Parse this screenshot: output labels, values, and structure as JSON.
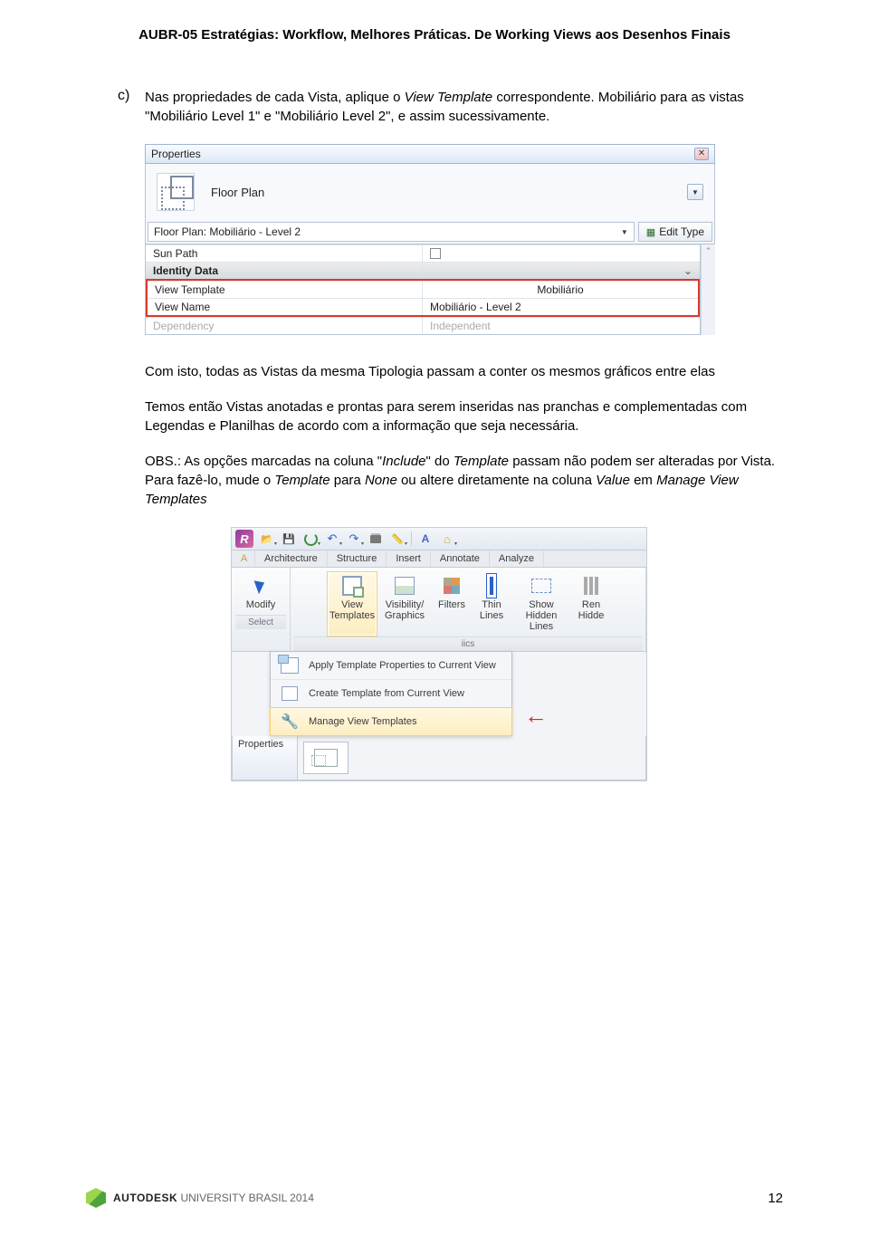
{
  "header": "AUBR-05 Estratégias: Workflow, Melhores Práticas. De Working Views aos Desenhos Finais",
  "list": {
    "marker": "c)",
    "text_before": "Nas propriedades de cada Vista, aplique o ",
    "italic1": "View Template",
    "text_mid": " correspondente. Mobiliário para as vistas \"Mobiliário Level 1\" e \"Mobiliário Level 2\", e assim sucessivamente."
  },
  "props": {
    "title": "Properties",
    "type_name": "Floor Plan",
    "instance": "Floor Plan: Mobiliário - Level 2",
    "edit_type": "Edit Type",
    "rows": {
      "sun_path": "Sun Path",
      "identity": "Identity Data",
      "vt_label": "View Template",
      "vt_value": "Mobiliário",
      "vn_label": "View Name",
      "vn_value": "Mobiliário - Level 2",
      "dep_label": "Dependency",
      "dep_value": "Independent"
    },
    "chevron": "⌃"
  },
  "para1": "Com isto, todas as Vistas da mesma Tipologia passam a conter os mesmos gráficos entre elas",
  "para2": "Temos então Vistas anotadas e prontas para serem inseridas nas pranchas e complementadas com Legendas e Planilhas de acordo com a informação que seja necessária.",
  "para3a": "OBS.: As opções marcadas na coluna \"",
  "para3i1": "Include",
  "para3b": "\" do ",
  "para3i2": "Template",
  "para3c": " passam não podem ser alteradas por Vista. Para fazê-lo, mude o ",
  "para3i3": "Template",
  "para3d": " para ",
  "para3i4": "None",
  "para3e": " ou altere diretamente na coluna ",
  "para3i5": "Value",
  "para3f": " em ",
  "para3i6": "Manage View Templates",
  "ribbon": {
    "tabs": {
      "home": "A",
      "arch": "Architecture",
      "struct": "Structure",
      "insert": "Insert",
      "annotate": "Annotate",
      "analyze": "Analyze"
    },
    "modify": "Modify",
    "select": "Select",
    "view_templates": "View Templates",
    "vis": "Visibility/ Graphics",
    "filters": "Filters",
    "thin": "Thin Lines",
    "show": "Show Hidden Lines",
    "ren": "Ren Hidde",
    "panel_label": "iics",
    "dd1": "Apply Template Properties to Current View",
    "dd2": "Create Template from Current View",
    "dd3": "Manage View Templates",
    "properties": "Properties",
    "r_letter": "R"
  },
  "footer": {
    "brand1": "AUTODESK",
    "brand2": " UNIVERSITY ",
    "brand3": "BRASIL 2014",
    "page": "12"
  }
}
